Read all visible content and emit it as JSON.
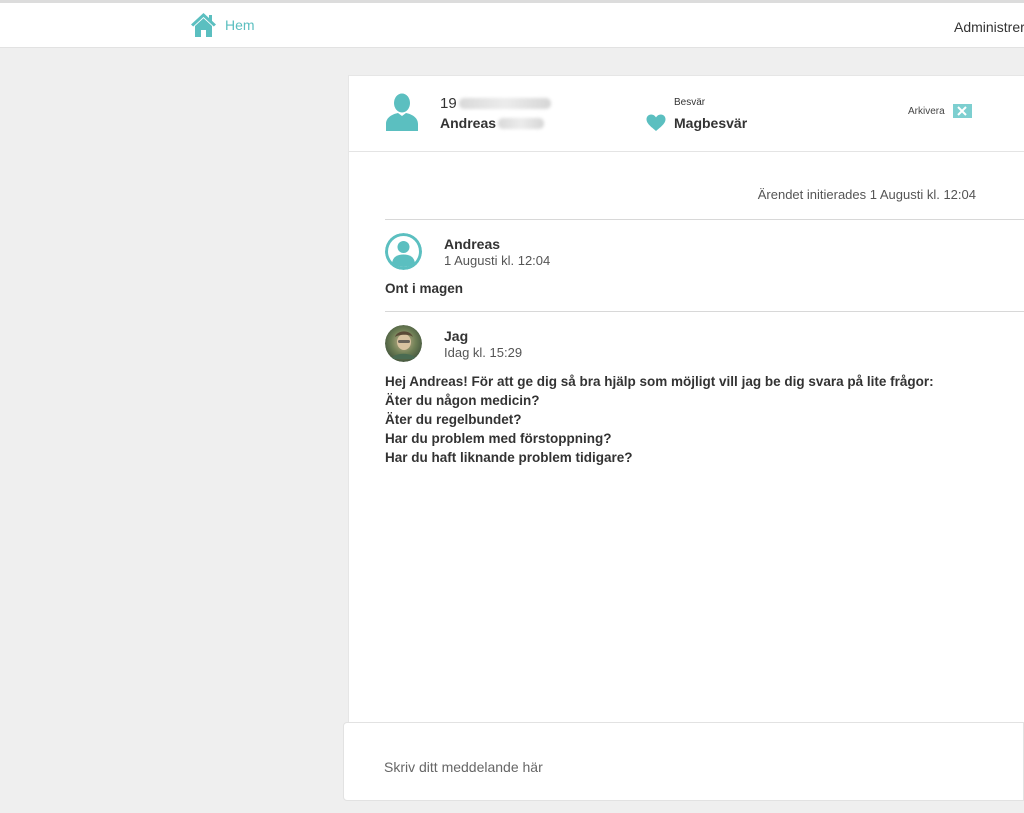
{
  "nav": {
    "home_label": "Hem",
    "admin_label": "Administrera"
  },
  "case": {
    "patient_id_prefix": "19",
    "patient_first_name": "Andreas",
    "complaint_label": "Besvär",
    "complaint_value": "Magbesvär",
    "archive_label": "Arkivera",
    "initiated_text": "Ärendet initierades 1 Augusti kl. 12:04"
  },
  "messages": [
    {
      "author": "Andreas",
      "time": "1 Augusti kl. 12:04",
      "lines": [
        "Ont i magen"
      ]
    },
    {
      "author": "Jag",
      "time": "Idag kl. 15:29",
      "lines": [
        "Hej Andreas!  För att ge dig så bra hjälp som möjligt vill jag be dig svara på lite  frågor:",
        "Äter du någon medicin?",
        "Äter du regelbundet?",
        "Har du problem med förstoppning?",
        "Har du haft liknande problem tidigare?"
      ]
    }
  ],
  "composer": {
    "placeholder": "Skriv ditt meddelande här",
    "value": ""
  },
  "colors": {
    "accent": "#5bbfc0",
    "accent_light": "#7dcfd0",
    "background": "#efefef"
  },
  "icons": {
    "home": "home-icon",
    "patient": "user-icon",
    "complaint": "heart-icon",
    "archive": "close-icon"
  }
}
